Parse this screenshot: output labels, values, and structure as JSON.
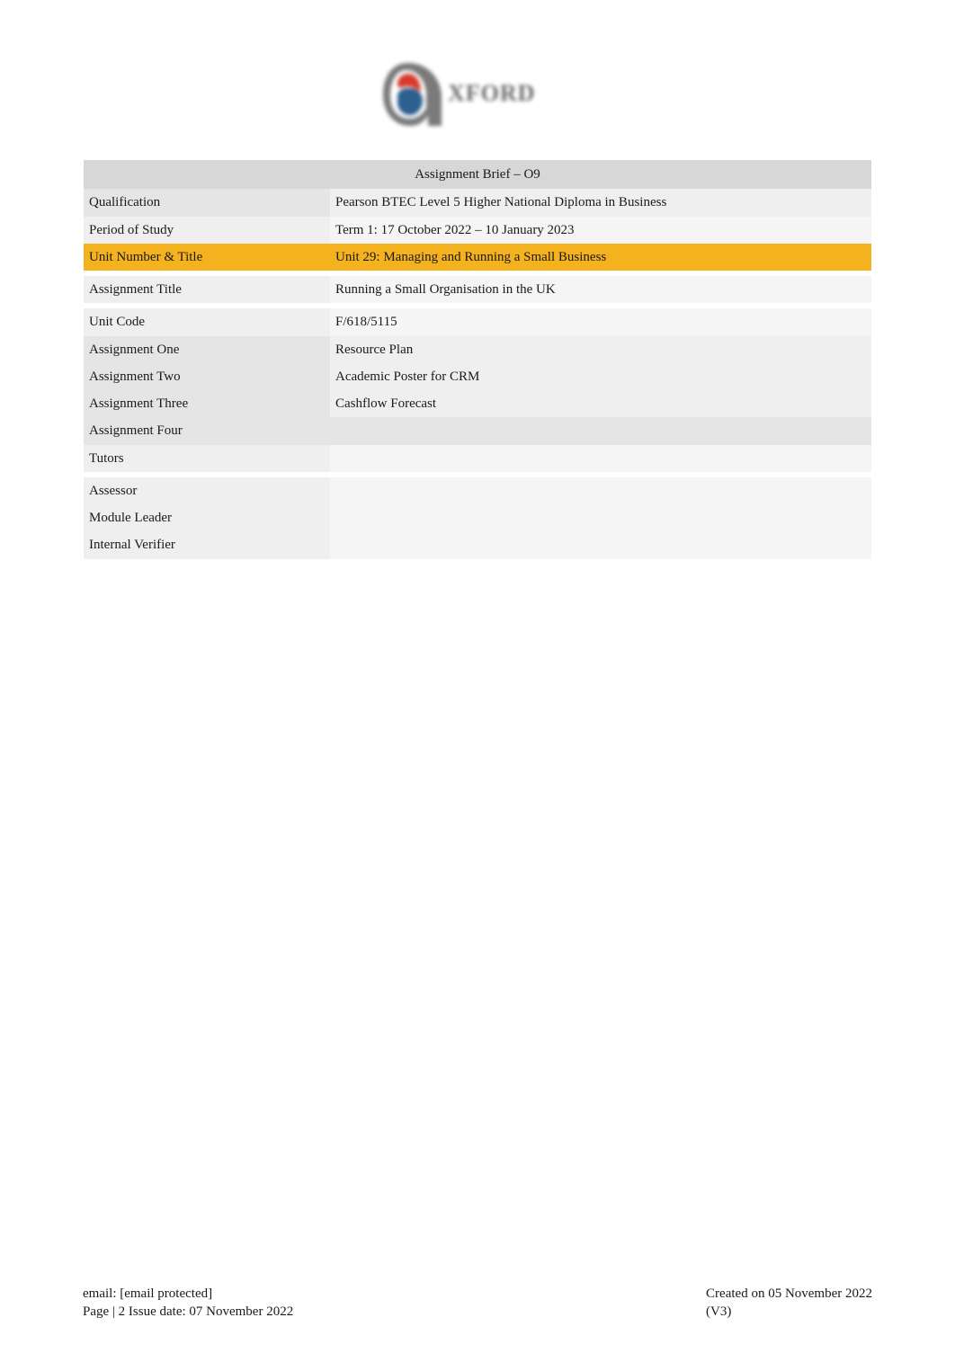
{
  "logo_alt": "Oxford",
  "brief": {
    "header": "Assignment Brief – O9",
    "rows": {
      "qualification": {
        "label": "Qualification",
        "value": "Pearson BTEC Level 5 Higher National Diploma in Business"
      },
      "period_of_study": {
        "label": "Period of Study",
        "value": "Term 1: 17 October 2022 – 10 January 2023"
      },
      "unit_number_title": {
        "label": "Unit Number & Title",
        "value": "Unit 29: Managing and Running a Small Business"
      },
      "assignment_title": {
        "label": "Assignment Title",
        "value": "Running a Small Organisation in the UK"
      },
      "unit_code": {
        "label": "Unit Code",
        "value": "F/618/5115"
      },
      "assignment_one": {
        "label": "Assignment One",
        "value": "Resource Plan"
      },
      "assignment_two": {
        "label": "Assignment Two",
        "value": "Academic Poster for CRM"
      },
      "assignment_three": {
        "label": "Assignment Three",
        "value": "Cashflow Forecast"
      },
      "assignment_four": {
        "label": "Assignment Four",
        "value": ""
      },
      "tutors": {
        "label": "Tutors",
        "value": ""
      },
      "assessor": {
        "label": "Assessor",
        "value": ""
      },
      "module_leader": {
        "label": "Module Leader",
        "value": ""
      },
      "internal_verifier": {
        "label": "Internal Verifier",
        "value": ""
      }
    }
  },
  "footer": {
    "email_line": "email: [email protected]",
    "page_line": "Page | 2 Issue date: 07 November 2022",
    "created_line": "Created on 05 November 2022",
    "version": "(V3)"
  }
}
